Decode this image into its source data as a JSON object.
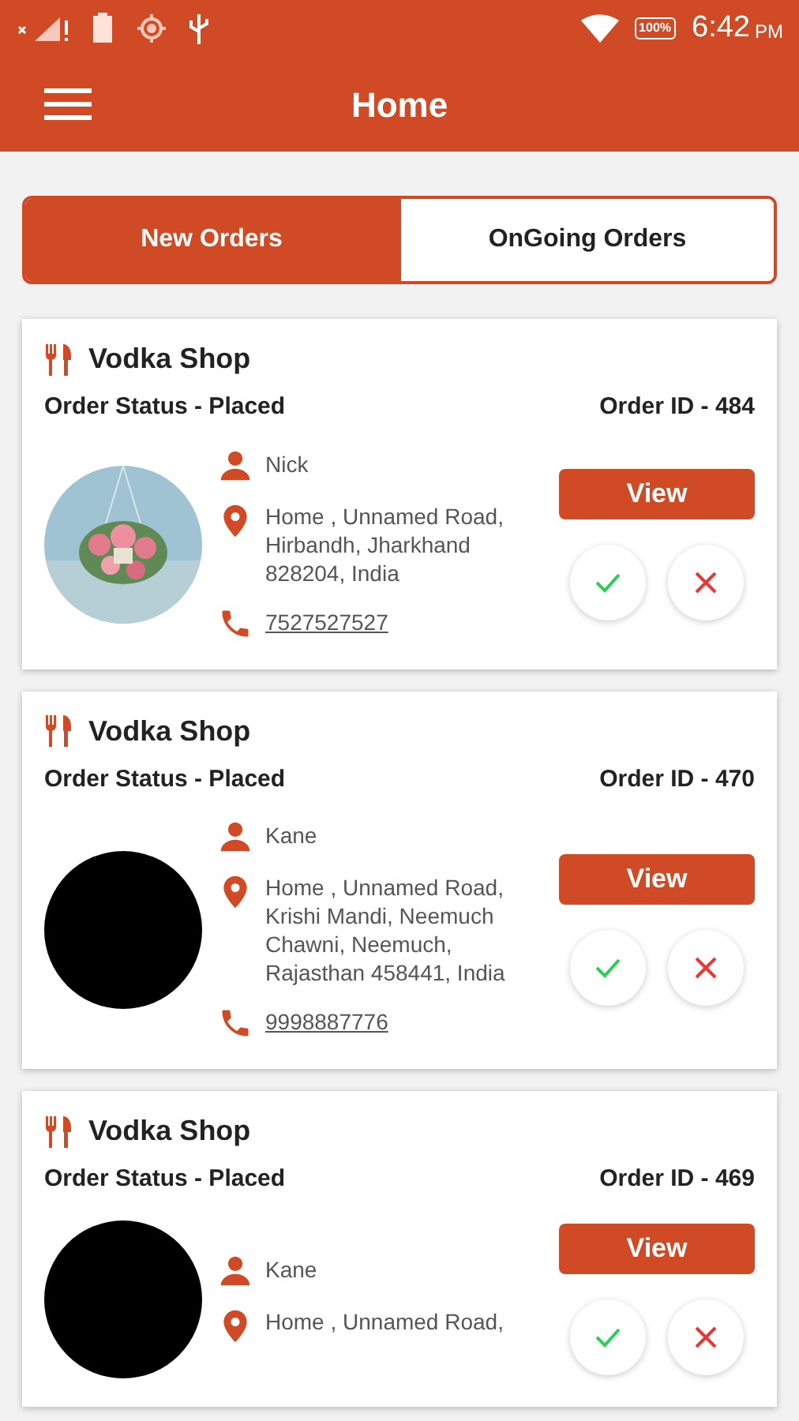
{
  "status_bar": {
    "battery": "100%",
    "time": "6:42",
    "ampm": "PM"
  },
  "app_bar": {
    "title": "Home"
  },
  "tabs": [
    {
      "label": "New Orders",
      "selected": true
    },
    {
      "label": "OnGoing Orders",
      "selected": false
    }
  ],
  "orders": [
    {
      "shop": "Vodka Shop",
      "status": "Order Status - Placed",
      "order_id": "Order ID - 484",
      "customer": "Nick",
      "address": "Home , Unnamed Road, Hirbandh, Jharkhand 828204, India",
      "phone": "7527527527",
      "view": "View"
    },
    {
      "shop": "Vodka Shop",
      "status": "Order Status - Placed",
      "order_id": "Order ID - 470",
      "avatar": {
        "kind": "blank"
      },
      "customer": "Kane",
      "address": "Home , Unnamed Road, Krishi Mandi, Neemuch Chawni, Neemuch, Rajasthan 458441, India",
      "phone": "9998887776",
      "view": "View"
    },
    {
      "shop": "Vodka Shop",
      "status": "Order Status - Placed",
      "order_id": "Order ID - 469",
      "avatar": {
        "kind": "blank"
      },
      "customer": "Kane",
      "address": "Home , Unnamed Road,",
      "view": "View"
    }
  ]
}
